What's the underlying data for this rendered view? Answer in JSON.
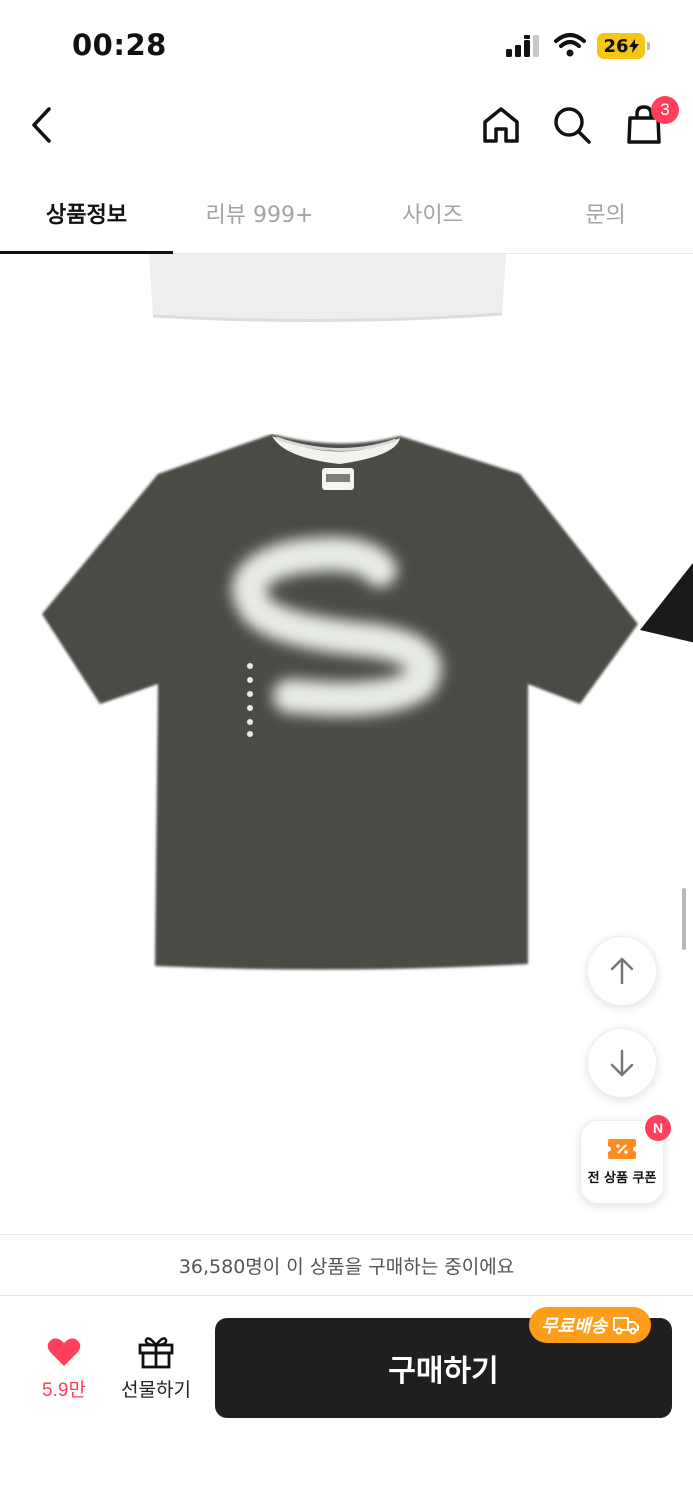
{
  "status_bar": {
    "time": "00:28",
    "battery": "26"
  },
  "top_nav": {
    "cart_count": "3"
  },
  "tabs": [
    {
      "label": "상품정보",
      "active": true
    },
    {
      "label": "리뷰 999+",
      "active": false
    },
    {
      "label": "사이즈",
      "active": false
    },
    {
      "label": "문의",
      "active": false
    }
  ],
  "floating": {
    "coupon_label": "전 상품 쿠폰",
    "coupon_badge": "N"
  },
  "buyers": {
    "text": "36,580명이 이 상품을 구매하는 중이에요"
  },
  "bottom": {
    "like_count": "5.9만",
    "gift_label": "선물하기",
    "buy_label": "구매하기",
    "free_shipping": "무료배송"
  },
  "colors": {
    "accent_red": "#ff3f5b",
    "shipping_orange": "#ff9c1a",
    "buy_button": "#1f1f1f",
    "shirt": "#4a4c45"
  }
}
